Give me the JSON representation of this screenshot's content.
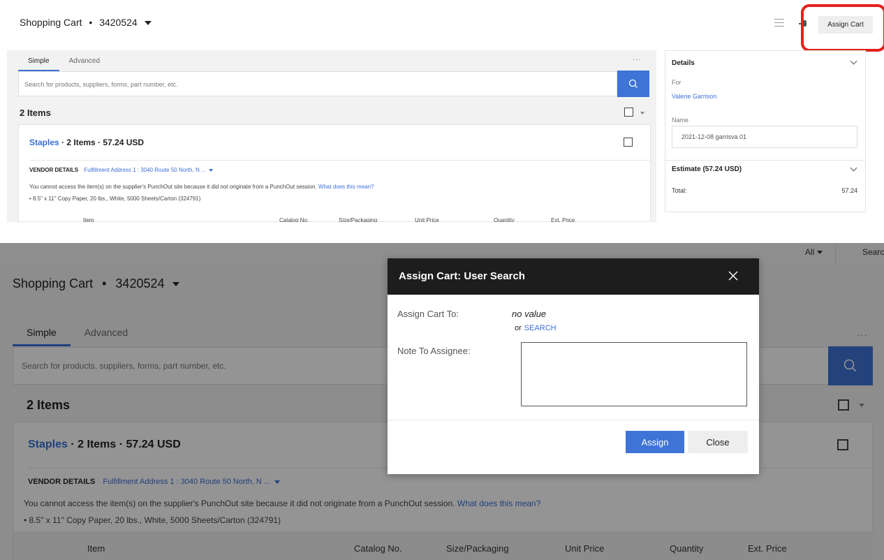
{
  "header": {
    "title": "Shopping Cart",
    "separator": "•",
    "cart_id": "3420524",
    "assign_cart_label": "Assign Cart"
  },
  "tabs": [
    {
      "label": "Simple",
      "active": true
    },
    {
      "label": "Advanced",
      "active": false
    }
  ],
  "more_label": "...",
  "search": {
    "placeholder": "Search for products, suppliers, forms, part number, etc."
  },
  "items_count": "2 Items",
  "cart": {
    "vendor": "Staples",
    "summary": "· 2 Items  · 57.24 USD",
    "vendor_details_label": "VENDOR DETAILS",
    "fulfillment_address": "Fulfillment Address 1 : 3040 Route 50 North, N ...",
    "punchout_message": "You cannot access the item(s) on the supplier's PunchOut site because it did not originate from a PunchOut session.",
    "punchout_link": "What does this mean?",
    "item_line": "• 8.5\" x 11\" Copy Paper, 20 lbs., White, 5000 Sheets/Carton (324791)",
    "columns": [
      "Item",
      "Catalog No.",
      "Size/Packaging",
      "Unit Price",
      "Quantity",
      "Ext. Price"
    ]
  },
  "details": {
    "title": "Details",
    "for_label": "For",
    "user": "Valerie Garrison",
    "name_label": "Name",
    "name_value": "2021-12-08 garrisva 01",
    "estimate_title": "Estimate (57.24 USD)",
    "total_label": "Total:",
    "total_value": "57.24"
  },
  "topbar": {
    "scope": "All",
    "search_label": "Searcl"
  },
  "modal": {
    "title": "Assign Cart: User Search",
    "assign_to_label": "Assign Cart To:",
    "assign_to_value": "no value",
    "or_label": "or",
    "search_link": "SEARCH",
    "note_label": "Note To Assignee:",
    "note_value": "",
    "assign_button": "Assign",
    "close_button": "Close"
  },
  "colors": {
    "accent": "#3e74d6",
    "link": "#3a6fd8",
    "highlight": "#e2211c",
    "modal_header": "#1d1d1d"
  }
}
